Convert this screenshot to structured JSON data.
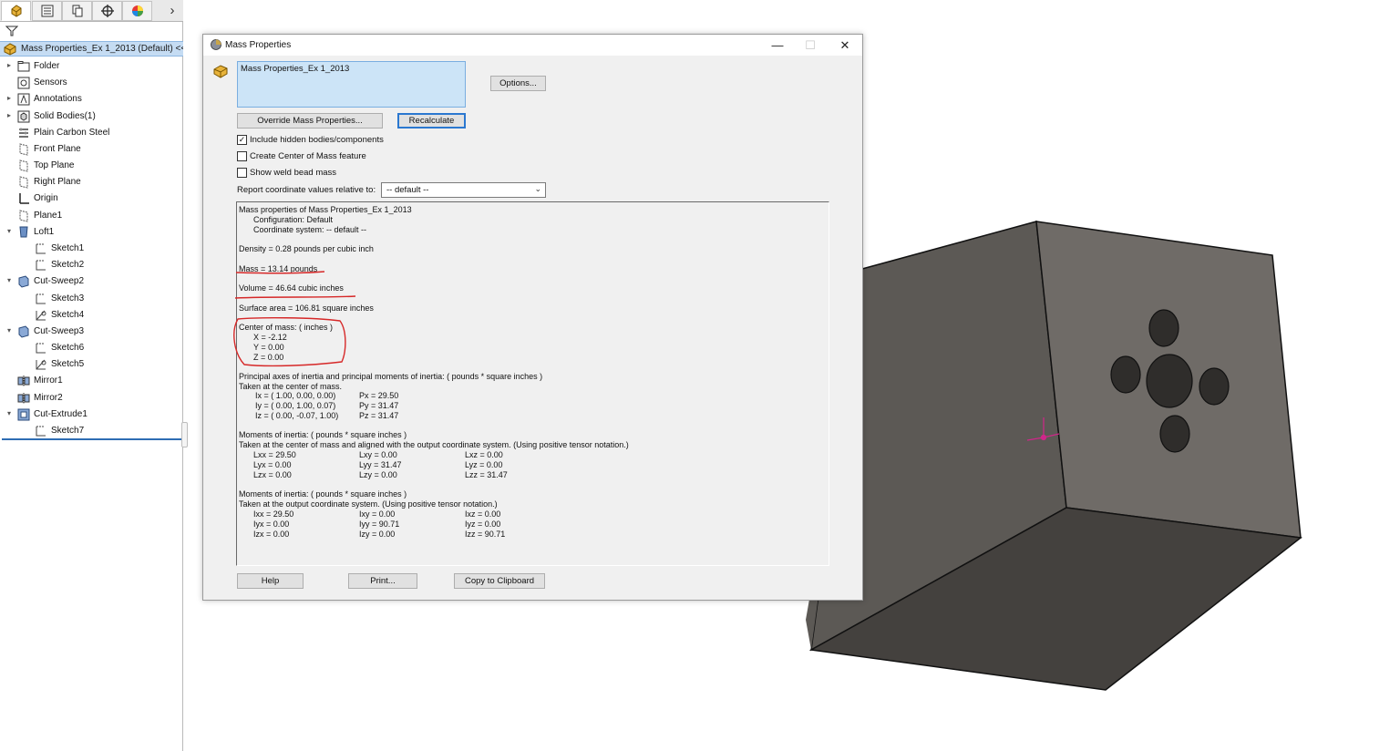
{
  "tree": {
    "tabs": [
      "feature-manager",
      "property-manager",
      "configuration-manager",
      "dimxpert-manager",
      "display-manager"
    ],
    "root_label": "Mass Properties_Ex 1_2013 (Default) <<D",
    "items": [
      {
        "label": "Folder",
        "icon": "folder-icon",
        "expander": "▸"
      },
      {
        "label": "Sensors",
        "icon": "sensors-icon",
        "expander": ""
      },
      {
        "label": "Annotations",
        "icon": "annotations-icon",
        "expander": "▸"
      },
      {
        "label": "Solid Bodies(1)",
        "icon": "solid-bodies-icon",
        "expander": "▸"
      },
      {
        "label": "Plain Carbon Steel",
        "icon": "material-icon",
        "expander": ""
      },
      {
        "label": "Front Plane",
        "icon": "plane-icon",
        "expander": ""
      },
      {
        "label": "Top Plane",
        "icon": "plane-icon",
        "expander": ""
      },
      {
        "label": "Right Plane",
        "icon": "plane-icon",
        "expander": ""
      },
      {
        "label": "Origin",
        "icon": "origin-icon",
        "expander": ""
      },
      {
        "label": "Plane1",
        "icon": "plane-icon",
        "expander": ""
      },
      {
        "label": "Loft1",
        "icon": "loft-icon",
        "expander": "▾"
      },
      {
        "label": "Sketch1",
        "icon": "sketch-icon",
        "expander": ""
      },
      {
        "label": "Sketch2",
        "icon": "sketch-icon",
        "expander": ""
      },
      {
        "label": "Cut-Sweep2",
        "icon": "cut-sweep-icon",
        "expander": "▾"
      },
      {
        "label": "Sketch3",
        "icon": "sketch-icon",
        "expander": ""
      },
      {
        "label": "Sketch4",
        "icon": "sketch-3d-icon",
        "expander": ""
      },
      {
        "label": "Cut-Sweep3",
        "icon": "cut-sweep-icon",
        "expander": "▾"
      },
      {
        "label": "Sketch6",
        "icon": "sketch-icon",
        "expander": ""
      },
      {
        "label": "Sketch5",
        "icon": "sketch-3d-icon",
        "expander": ""
      },
      {
        "label": "Mirror1",
        "icon": "mirror-icon",
        "expander": ""
      },
      {
        "label": "Mirror2",
        "icon": "mirror-icon",
        "expander": ""
      },
      {
        "label": "Cut-Extrude1",
        "icon": "cut-extrude-icon",
        "expander": "▾"
      },
      {
        "label": "Sketch7",
        "icon": "sketch-icon",
        "expander": ""
      }
    ]
  },
  "dialog": {
    "title": "Mass Properties",
    "selection_value": "Mass Properties_Ex 1_2013",
    "options_label": "Options...",
    "override_label": "Override Mass Properties...",
    "recalculate_label": "Recalculate",
    "include_hidden": {
      "label": "Include hidden bodies/components",
      "checked": true,
      "mark": "✓"
    },
    "create_com": {
      "label": "Create Center of Mass feature",
      "checked": false,
      "mark": ""
    },
    "show_weld": {
      "label": "Show weld bead mass",
      "checked": false,
      "mark": ""
    },
    "report_label": "Report coordinate values relative to:",
    "report_value": "-- default --",
    "help_label": "Help",
    "print_label": "Print...",
    "copy_label": "Copy to Clipboard",
    "results": [
      "Mass properties of Mass Properties_Ex 1_2013",
      "Configuration: Default",
      "Coordinate system: -- default --",
      "Density = 0.28 pounds per cubic inch",
      "Mass = 13.14 pounds",
      "Volume = 46.64 cubic inches",
      "Surface area = 106.81 square inches",
      "Center of mass: ( inches )",
      "X = -2.12",
      "Y = 0.00",
      "Z = 0.00",
      "Principal axes of inertia and principal moments of inertia: ( pounds * square inches )",
      "Taken at the center of mass.",
      "Ix = ( 1.00,  0.00,  0.00)",
      "Px = 29.50",
      "Iy = ( 0.00,  1.00,  0.07)",
      "Py = 31.47",
      "Iz = ( 0.00, -0.07,  1.00)",
      "Pz = 31.47",
      "Moments of inertia: ( pounds * square inches )",
      "Taken at the center of mass and aligned with the output coordinate system. (Using positive tensor notation.)",
      "Lxx = 29.50",
      "Lxy = 0.00",
      "Lxz = 0.00",
      "Lyx = 0.00",
      "Lyy = 31.47",
      "Lyz = 0.00",
      "Lzx = 0.00",
      "Lzy = 0.00",
      "Lzz = 31.47",
      "Moments of inertia: ( pounds * square inches )",
      "Taken at the output coordinate system. (Using positive tensor notation.)",
      "Ixx = 29.50",
      "Ixy = 0.00",
      "Ixz = 0.00",
      "Iyx = 0.00",
      "Iyy = 90.71",
      "Iyz = 0.00",
      "Izx = 0.00",
      "Izy = 0.00",
      "Izz = 90.71"
    ]
  },
  "colors": {
    "annotation_red": "#d62828",
    "selection_blue": "#cce4f7",
    "cube_front": "#5c5955",
    "cube_side": "#6f6b67",
    "cube_top": "#44413e"
  }
}
